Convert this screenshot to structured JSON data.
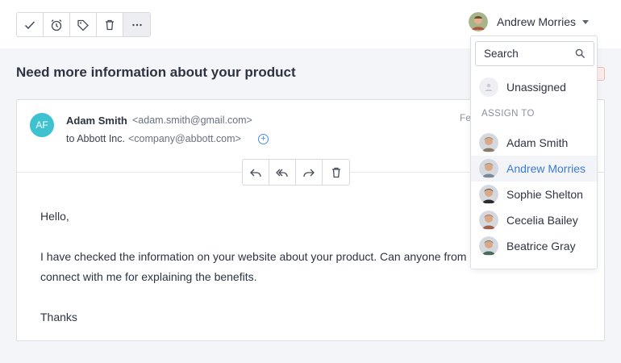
{
  "toolbar": {
    "buttons": [
      {
        "icon": "check-icon"
      },
      {
        "icon": "snooze-clock-icon"
      },
      {
        "icon": "tag-icon"
      },
      {
        "icon": "trash-icon"
      },
      {
        "icon": "more-icon",
        "label": "···"
      }
    ]
  },
  "assignee": {
    "name": "Andrew Morries"
  },
  "conversation": {
    "subject": "Need more information about your product"
  },
  "message": {
    "sender_initials": "AF",
    "sender_name": "Adam Smith",
    "sender_email": "<adam.smith@gmail.com>",
    "to_prefix": "to Abbott Inc.",
    "to_email": "<company@abbott.com>",
    "add_recipient": "+",
    "date": "Fe",
    "greeting": "Hello,",
    "body_line1": "I have checked the information on your website about your product. Can anyone from",
    "body_line2": "connect with me for explaining the benefits.",
    "signoff": "Thanks"
  },
  "dropdown": {
    "search_placeholder": "Search",
    "unassigned_label": "Unassigned",
    "section_label": "ASSIGN TO",
    "people": [
      {
        "name": "Adam Smith",
        "selected": false,
        "color": "#8a7a6a"
      },
      {
        "name": "Andrew Morries",
        "selected": true,
        "color": "#7a8a96"
      },
      {
        "name": "Sophie Shelton",
        "selected": false,
        "color": "#2b2b2b"
      },
      {
        "name": "Cecelia Bailey",
        "selected": false,
        "color": "#a0604a"
      },
      {
        "name": "Beatrice Gray",
        "selected": false,
        "color": "#4a6a5a"
      }
    ]
  },
  "colors": {
    "accent": "#3a7bd5",
    "sender_avatar": "#3ec2cf"
  }
}
